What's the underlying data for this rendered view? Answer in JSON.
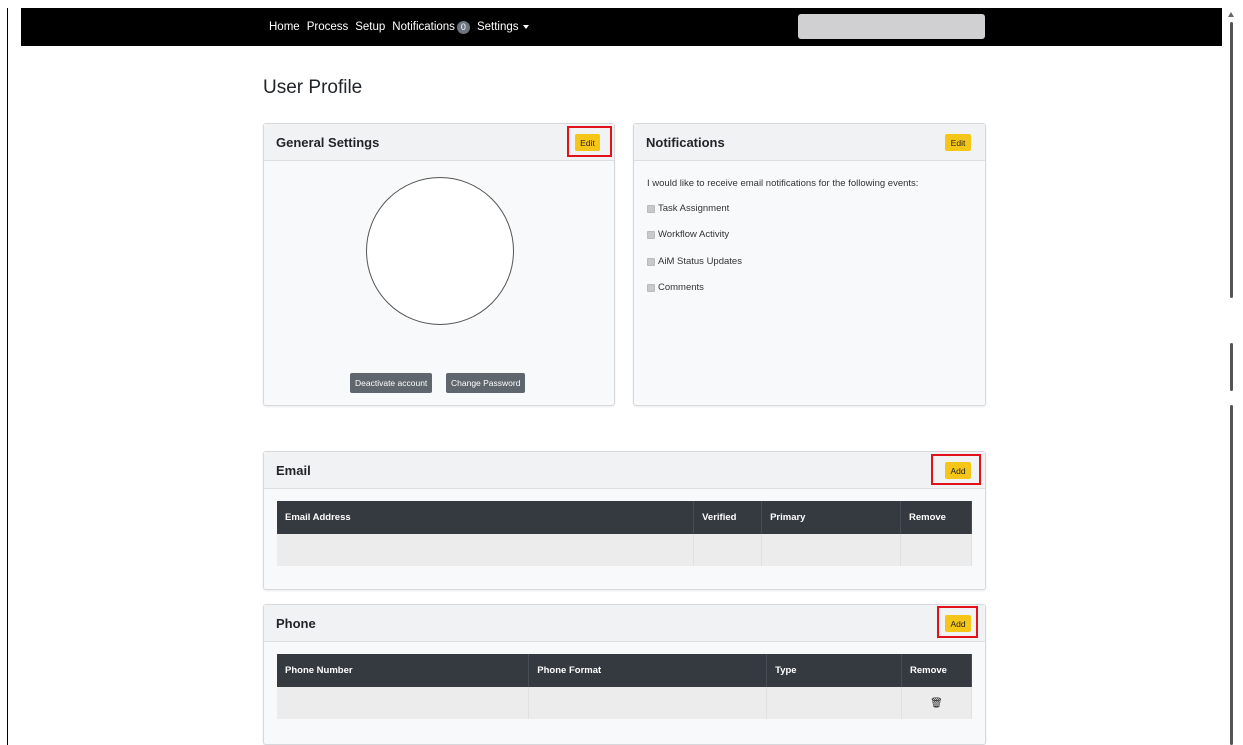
{
  "nav": {
    "home": "Home",
    "process": "Process",
    "setup": "Setup",
    "notifications": "Notifications",
    "notifications_count": "0",
    "settings": "Settings",
    "search_value": ""
  },
  "page": {
    "title": "User Profile"
  },
  "general": {
    "title": "General Settings",
    "edit_label": "Edit",
    "deactivate_label": "Deactivate account",
    "change_password_label": "Change Password"
  },
  "notifications": {
    "title": "Notifications",
    "edit_label": "Edit",
    "intro": "I would like to receive email notifications for the following events:",
    "items": [
      {
        "label": "Task Assignment",
        "checked": true
      },
      {
        "label": "Workflow Activity",
        "checked": true
      },
      {
        "label": "AiM Status Updates",
        "checked": true
      },
      {
        "label": "Comments",
        "checked": true
      }
    ]
  },
  "email": {
    "title": "Email",
    "add_label": "Add",
    "columns": [
      "Email Address",
      "Verified",
      "Primary",
      "Remove"
    ]
  },
  "phone": {
    "title": "Phone",
    "add_label": "Add",
    "columns": [
      "Phone Number",
      "Phone Format",
      "Type",
      "Remove"
    ]
  },
  "icons": {
    "trash": "trash-icon",
    "avatar": "avatar-placeholder"
  },
  "colors": {
    "navbar": "#000000",
    "accent": "#f5c518",
    "highlight": "#e3111a",
    "table_header": "#343a40"
  }
}
